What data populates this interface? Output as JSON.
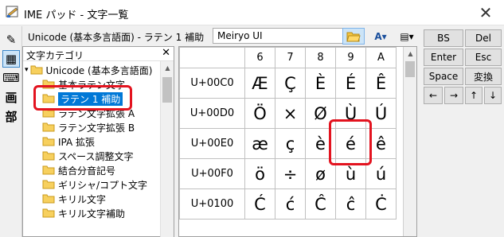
{
  "window": {
    "title": "IME パッド - 文字一覧",
    "close_glyph": "✕"
  },
  "left_tools": [
    {
      "icon": "handwriting-icon",
      "glyph": "✎"
    },
    {
      "icon": "char-list-icon",
      "glyph": "▦"
    },
    {
      "icon": "soft-keyboard-icon",
      "glyph": "⌨"
    },
    {
      "icon": "stroke-count-icon",
      "glyph": "画"
    },
    {
      "icon": "radical-icon",
      "glyph": "部"
    }
  ],
  "header": {
    "category_title": "Unicode (基本多言語面) - ラテン 1 補助",
    "font_select": {
      "value": "Meiryo UI",
      "arrow": "▼"
    },
    "toolbar_buttons": [
      {
        "icon": "open-folder-icon",
        "glyph": "📂"
      },
      {
        "icon": "font-size-icon",
        "glyph": "A▾"
      },
      {
        "icon": "view-options-icon",
        "glyph": "▤▾"
      }
    ]
  },
  "tree": {
    "header_label": "文字カテゴリ",
    "close_glyph": "✕",
    "items": [
      {
        "label": "Unicode (基本多言語面)",
        "expander": "▾",
        "level": 0,
        "selected": false
      },
      {
        "label": "基本ラテン文字",
        "level": 1,
        "selected": false
      },
      {
        "label": "ラテン 1 補助",
        "level": 1,
        "selected": true
      },
      {
        "label": "ラテン文字拡張 A",
        "level": 1,
        "selected": false
      },
      {
        "label": "ラテン文字拡張 B",
        "level": 1,
        "selected": false
      },
      {
        "label": "IPA 拡張",
        "level": 1,
        "selected": false
      },
      {
        "label": "スペース調整文字",
        "level": 1,
        "selected": false
      },
      {
        "label": "結合分音記号",
        "level": 1,
        "selected": false
      },
      {
        "label": "ギリシャ/コプト文字",
        "level": 1,
        "selected": false
      },
      {
        "label": "キリル文字",
        "level": 1,
        "selected": false
      },
      {
        "label": "キリル文字補助",
        "level": 1,
        "selected": false
      }
    ]
  },
  "char_grid": {
    "columns": [
      "6",
      "7",
      "8",
      "9",
      "A"
    ],
    "rows": [
      {
        "code": "U+00C0",
        "chars": [
          "Æ",
          "Ç",
          "È",
          "É",
          "Ê"
        ]
      },
      {
        "code": "U+00D0",
        "chars": [
          "Ö",
          "×",
          "Ø",
          "Ù",
          "Ú"
        ]
      },
      {
        "code": "U+00E0",
        "chars": [
          "æ",
          "ç",
          "è",
          "é",
          "ê"
        ]
      },
      {
        "code": "U+00F0",
        "chars": [
          "ö",
          "÷",
          "ø",
          "ù",
          "ú"
        ]
      },
      {
        "code": "U+0100",
        "chars": [
          "Ć",
          "ć",
          "Ĉ",
          "ĉ",
          "Ċ"
        ]
      }
    ]
  },
  "keys": {
    "bs": "BS",
    "del": "Del",
    "enter": "Enter",
    "esc": "Esc",
    "space": "Space",
    "convert": "変換",
    "left": "←",
    "right": "→",
    "up": "↑",
    "down": "↓"
  },
  "colors": {
    "selection": "#0078d7",
    "highlight": "#e3131f"
  }
}
